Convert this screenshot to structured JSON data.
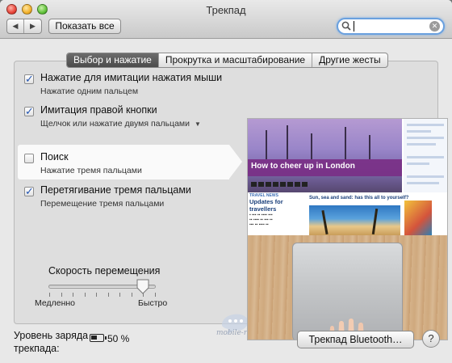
{
  "window": {
    "title": "Трекпад"
  },
  "toolbar": {
    "back_label": "◀",
    "forward_label": "▶",
    "show_all_label": "Показать все",
    "search_value": "",
    "search_placeholder": ""
  },
  "tabs": [
    {
      "label": "Выбор и нажатие",
      "active": true
    },
    {
      "label": "Прокрутка и масштабирование",
      "active": false
    },
    {
      "label": "Другие жесты",
      "active": false
    }
  ],
  "options": [
    {
      "label": "Нажатие для имитации нажатия мыши",
      "sub": "Нажатие одним пальцем",
      "checked": true,
      "has_menu": false
    },
    {
      "label": "Имитация правой кнопки",
      "sub": "Щелчок или нажатие двумя пальцами",
      "checked": true,
      "has_menu": true
    },
    {
      "label": "Поиск",
      "sub": "Нажатие тремя пальцами",
      "checked": false,
      "has_menu": false,
      "highlighted": true
    },
    {
      "label": "Перетягивание тремя пальцами",
      "sub": "Перемещение тремя пальцами",
      "checked": true,
      "has_menu": false
    }
  ],
  "speed": {
    "title": "Скорость перемещения",
    "min_label": "Медленно",
    "max_label": "Быстро",
    "value_fraction": 0.88,
    "tick_count": 10
  },
  "preview": {
    "headline": "How to cheer up in London",
    "section_kicker": "TRAVEL NEWS",
    "section_title": "Updates for travellers",
    "beach_caption": "Sun, sea and sand: has this all to yourself?"
  },
  "watermark": {
    "text": "mobile-review.com"
  },
  "footer": {
    "battery_label": "Уровень заряда\nтрекпада:",
    "battery_line1": "Уровень заряда",
    "battery_line2": "трекпада:",
    "battery_percent": "50 %",
    "battery_level": 0.5,
    "bluetooth_button": "Трекпад Bluetooth…",
    "help_label": "?"
  },
  "colors": {
    "accent": "#2355b2",
    "active_tab": "#5b5b5b",
    "search_focus": "#6aa0de"
  }
}
